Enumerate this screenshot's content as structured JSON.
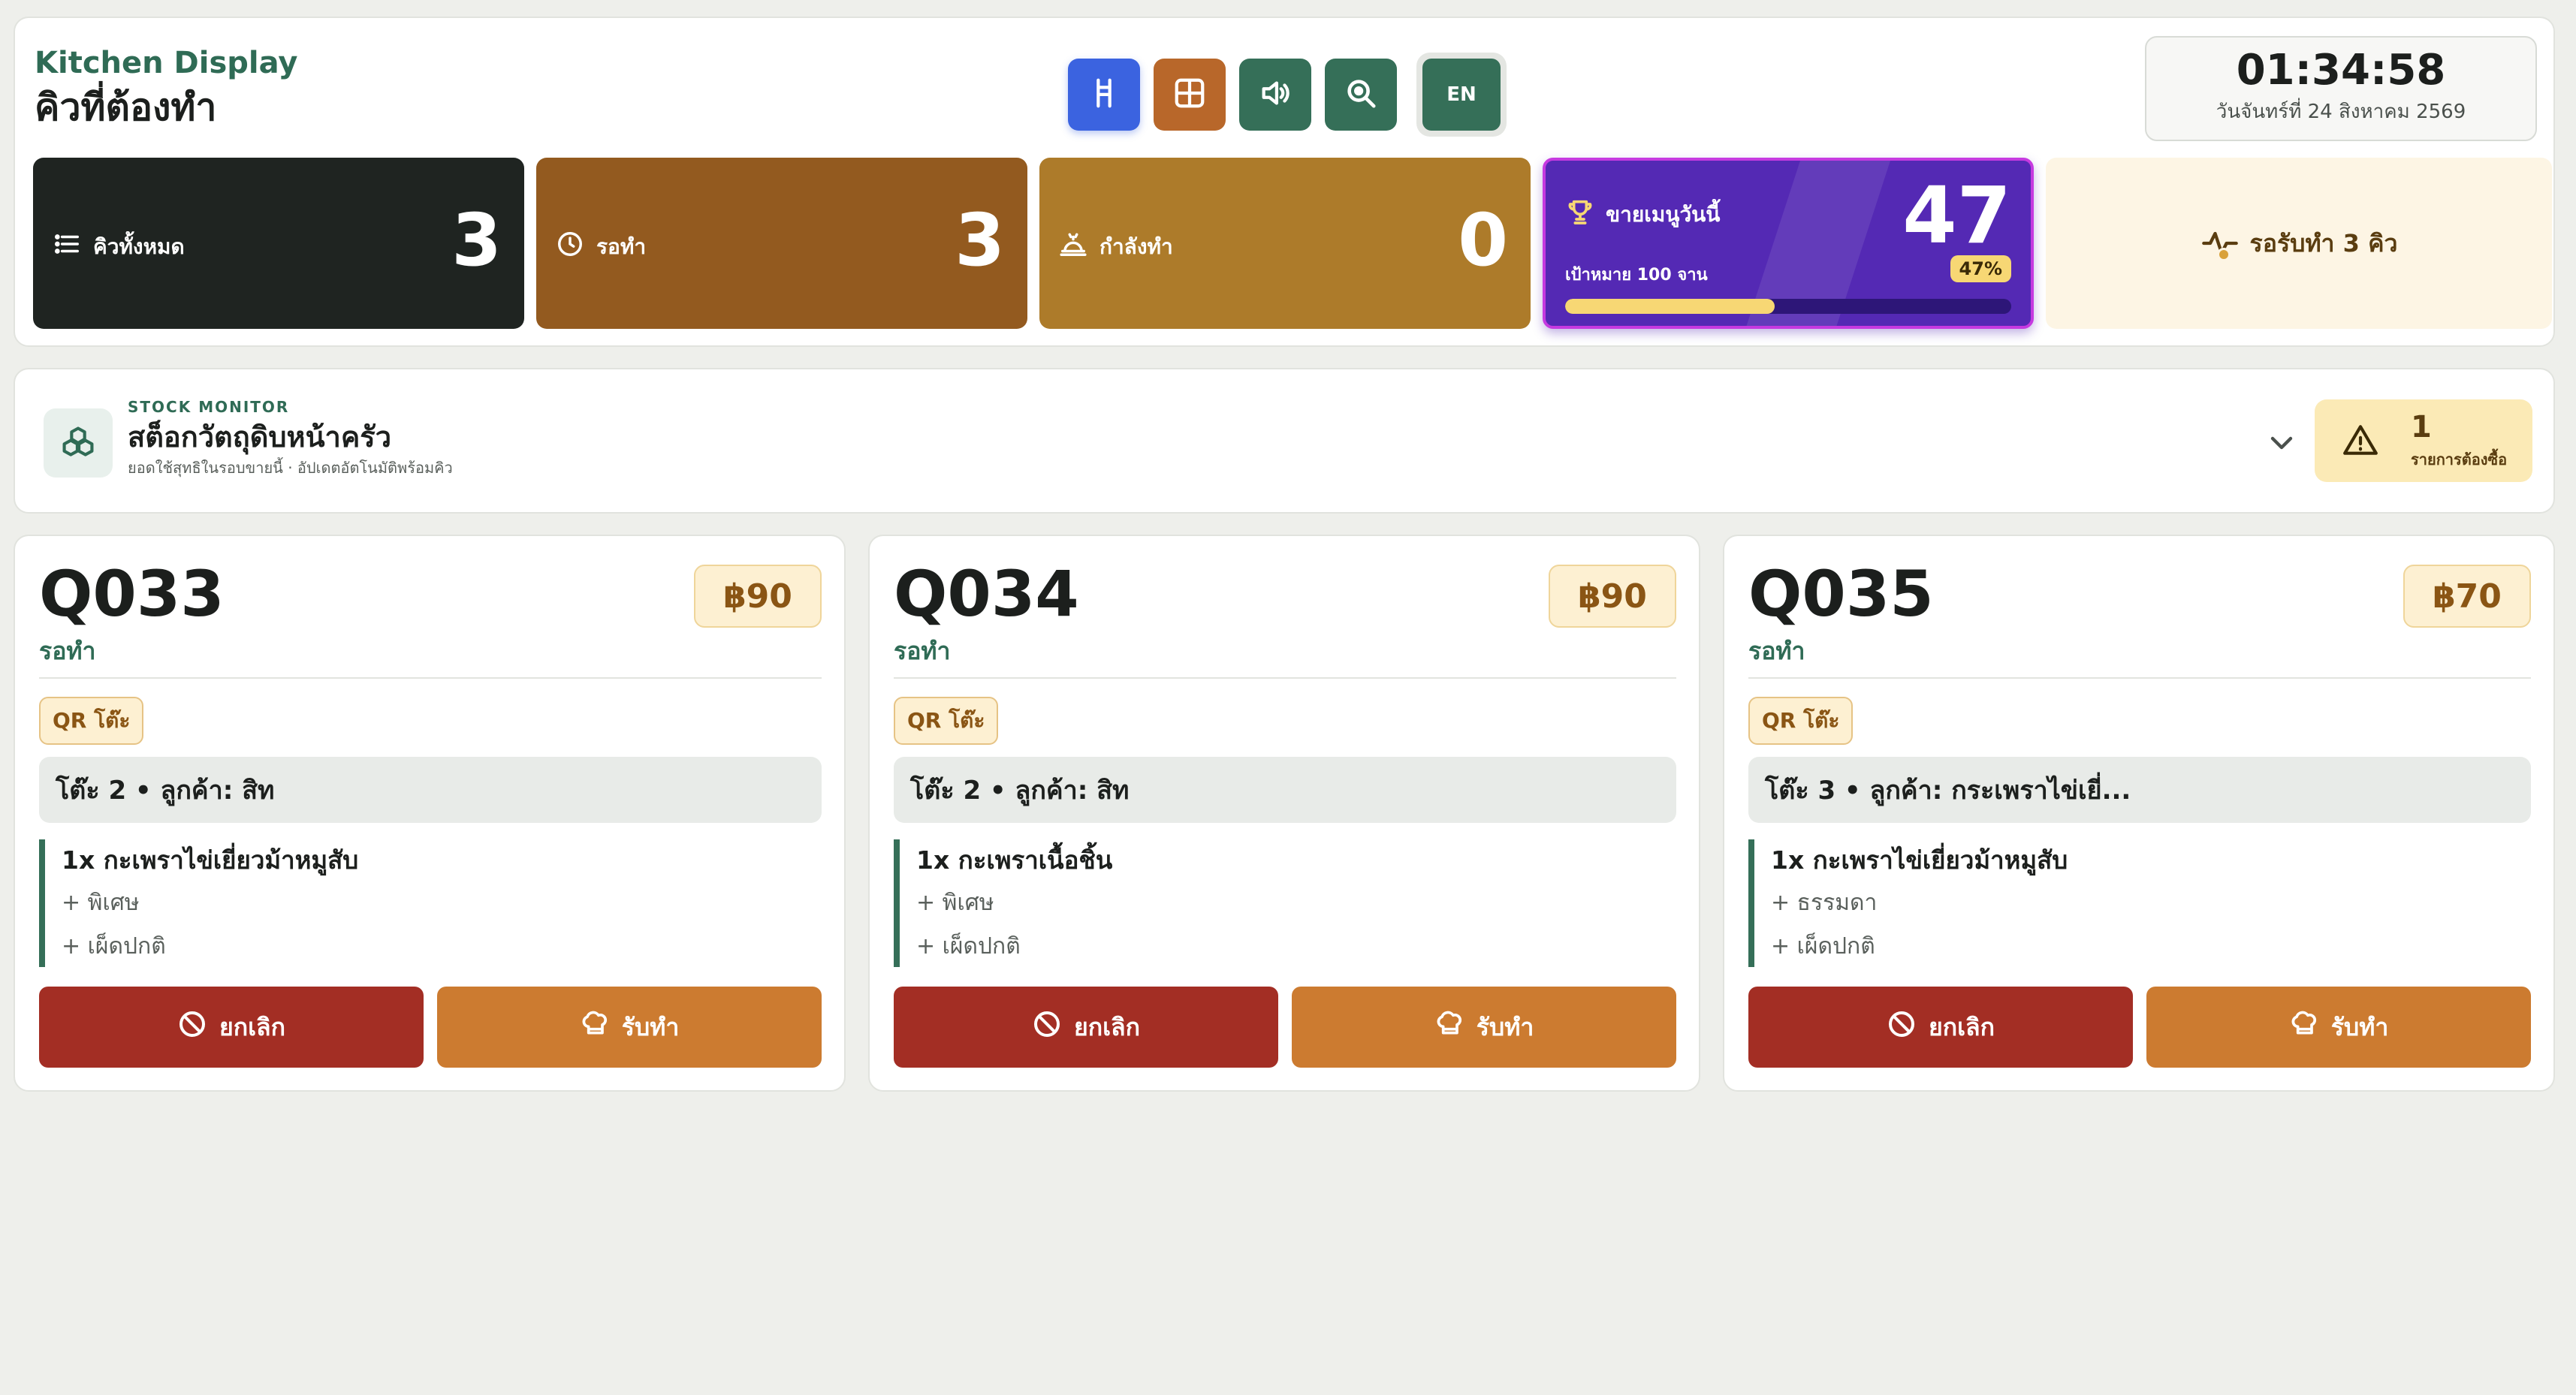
{
  "header": {
    "subtitle": "Kitchen Display",
    "title": "คิวที่ต้องทำ",
    "language_label": "EN",
    "clock_time": "01:34:58",
    "clock_date": "วันจันทร์ที่ 24 สิงหาคม 2569"
  },
  "toolbar": {
    "icons": [
      "ladder-icon",
      "grid-icon",
      "volume-icon",
      "zoom-search-icon"
    ],
    "colors": {
      "blue": "#3b63e0",
      "orange": "#b8672a",
      "green": "#356f58"
    }
  },
  "stats": {
    "total": {
      "label": "คิวทั้งหมด",
      "value": "3",
      "icon": "list-icon"
    },
    "waiting": {
      "label": "รอทำ",
      "value": "3",
      "icon": "clock-icon"
    },
    "cooking": {
      "label": "กำลังทำ",
      "value": "0",
      "icon": "cooking-pot-icon"
    },
    "sales": {
      "label": "ขายเมนูวันนี้",
      "value": "47",
      "goal": "เป้าหมาย 100 จาน",
      "percent_label": "47%",
      "progress": 0.47,
      "icon": "trophy-icon"
    },
    "pending": {
      "label": "รอรับทำ 3 คิว",
      "icon": "activity-icon"
    }
  },
  "stock": {
    "eyebrow": "STOCK MONITOR",
    "title": "สต็อกวัตถุดิบหน้าครัว",
    "note": "ยอดใช้สุทธิในรอบขายนี้ · อัปเดตอัตโนมัติพร้อมคิว",
    "alert_count": "1",
    "alert_label": "รายการต้องซื้อ",
    "icon": "boxes-icon"
  },
  "orders": [
    {
      "number": "Q033",
      "status": "รอทำ",
      "price": "฿90",
      "source": "QR โต๊ะ",
      "table_info": "โต๊ะ 2 • ลูกค้า: สิท",
      "item": "1x กะเพราไข่เยี่ยวม้าหมูสับ",
      "mods": [
        "+ พิเศษ",
        "+ เผ็ดปกติ"
      ],
      "cancel_label": "ยกเลิก",
      "accept_label": "รับทำ"
    },
    {
      "number": "Q034",
      "status": "รอทำ",
      "price": "฿90",
      "source": "QR โต๊ะ",
      "table_info": "โต๊ะ 2 • ลูกค้า: สิท",
      "item": "1x กะเพราเนื้อชิ้น",
      "mods": [
        "+ พิเศษ",
        "+ เผ็ดปกติ"
      ],
      "cancel_label": "ยกเลิก",
      "accept_label": "รับทำ"
    },
    {
      "number": "Q035",
      "status": "รอทำ",
      "price": "฿70",
      "source": "QR โต๊ะ",
      "table_info": "โต๊ะ 3 • ลูกค้า: กระเพราไข่เยี่...",
      "item": "1x กะเพราไข่เยี่ยวม้าหมูสับ",
      "mods": [
        "+ ธรรมดา",
        "+ เผ็ดปกติ"
      ],
      "cancel_label": "ยกเลิก",
      "accept_label": "รับทำ"
    }
  ]
}
